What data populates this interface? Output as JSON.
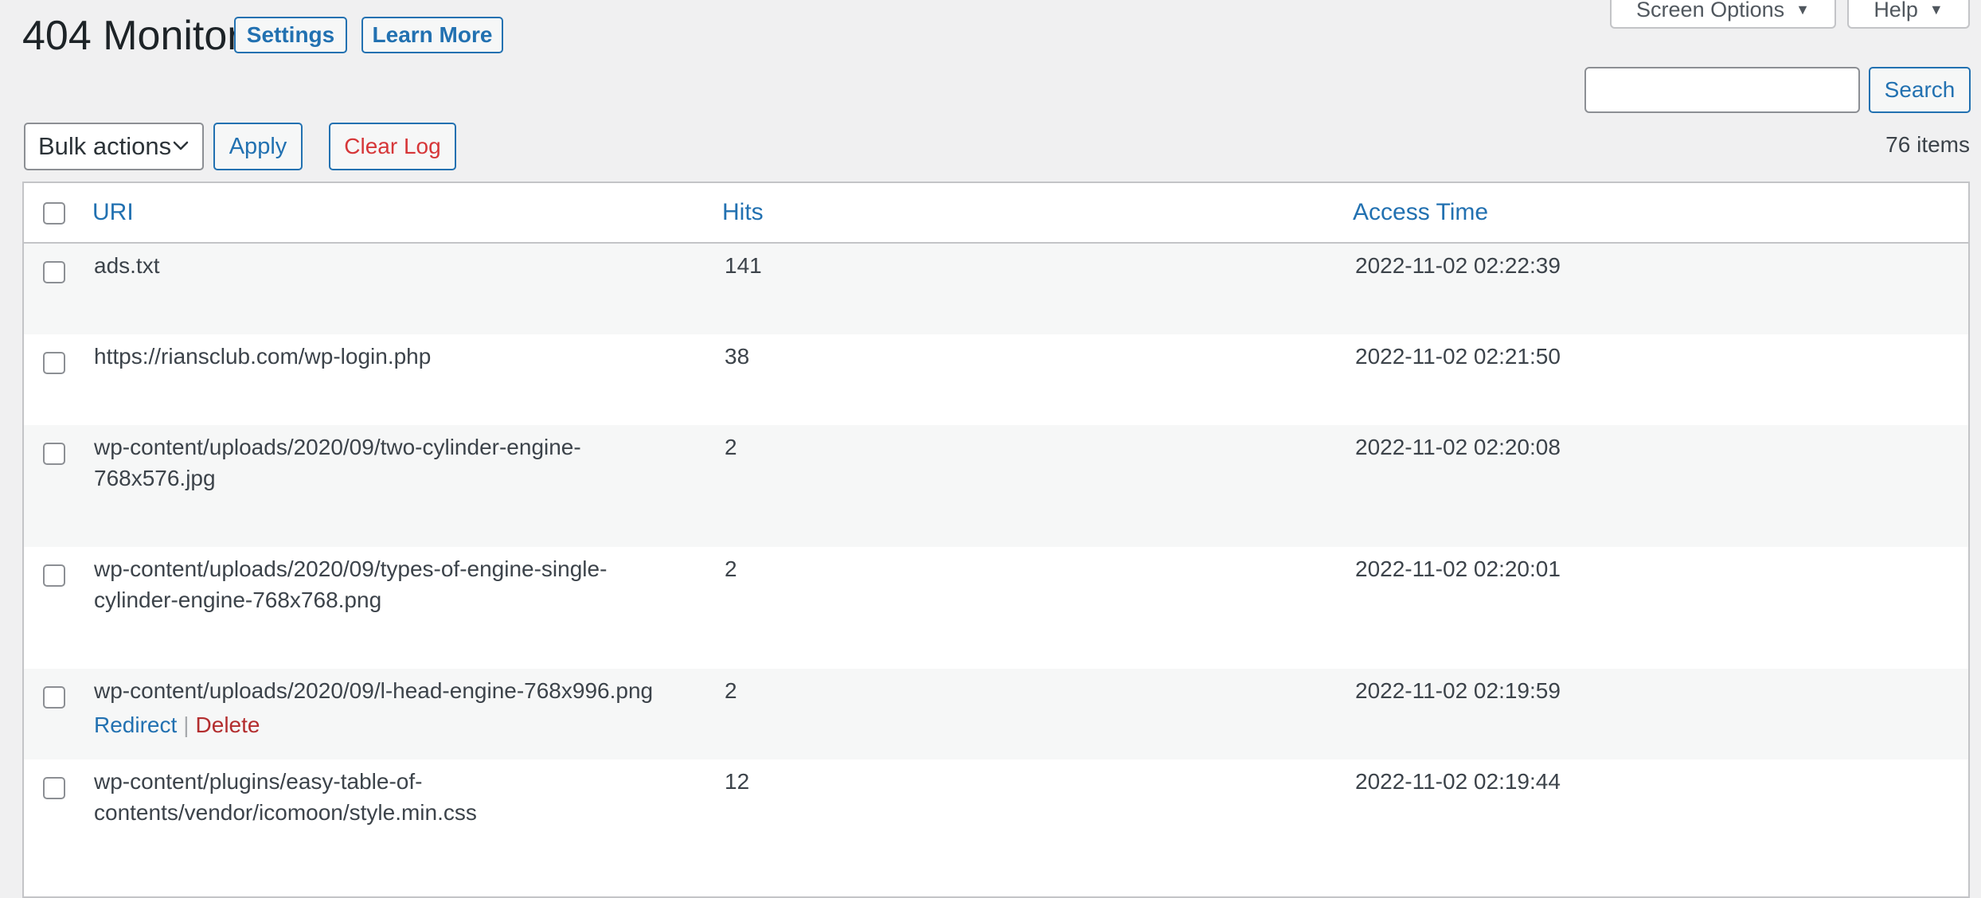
{
  "header": {
    "title": "404 Monitor",
    "settings_label": "Settings",
    "learn_more_label": "Learn More",
    "screen_options_label": "Screen Options",
    "help_label": "Help"
  },
  "search": {
    "value": "",
    "button_label": "Search"
  },
  "toolbar": {
    "bulk_actions_label": "Bulk actions",
    "apply_label": "Apply",
    "clear_log_label": "Clear Log",
    "item_count": "76 items"
  },
  "table": {
    "columns": {
      "uri": "URI",
      "hits": "Hits",
      "access_time": "Access Time"
    },
    "rows": [
      {
        "uri": "ads.txt",
        "hits": "141",
        "time": "2022-11-02 02:22:39"
      },
      {
        "uri": "https://riansclub.com/wp-login.php",
        "hits": "38",
        "time": "2022-11-02 02:21:50"
      },
      {
        "uri": "wp-content/uploads/2020/09/two-cylinder-engine-768x576.jpg",
        "hits": "2",
        "time": "2022-11-02 02:20:08"
      },
      {
        "uri": "wp-content/uploads/2020/09/types-of-engine-single-cylinder-engine-768x768.png",
        "hits": "2",
        "time": "2022-11-02 02:20:01"
      },
      {
        "uri": "wp-content/uploads/2020/09/l-head-engine-768x996.png",
        "hits": "2",
        "time": "2022-11-02 02:19:59"
      },
      {
        "uri": "wp-content/plugins/easy-table-of-contents/vendor/icomoon/style.min.css",
        "hits": "12",
        "time": "2022-11-02 02:19:44"
      }
    ],
    "row_actions": {
      "redirect": "Redirect",
      "separator": "|",
      "delete": "Delete"
    }
  }
}
